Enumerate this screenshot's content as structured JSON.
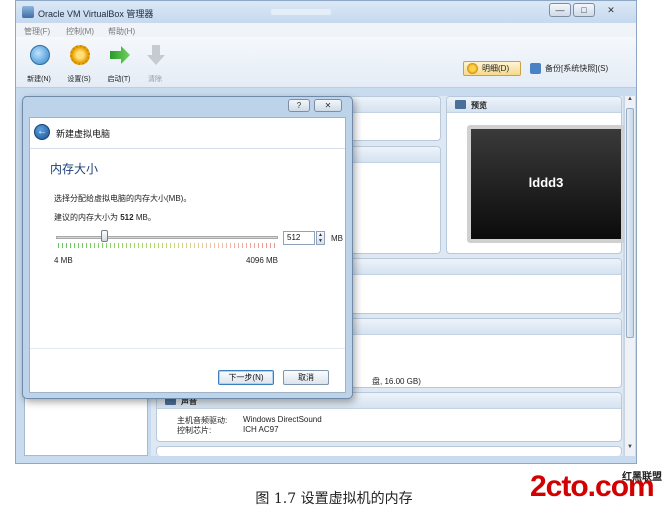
{
  "window": {
    "title": "Oracle VM VirtualBox 管理器"
  },
  "menu": [
    "管理(F)",
    "控制(M)",
    "帮助(H)"
  ],
  "toolbar": {
    "new_label": "新建(N)",
    "settings_label": "设置(S)",
    "start_label": "启动(T)",
    "discard_label": "清除",
    "details_label": "明细(D)",
    "snapshots_label": "备份[系统快照](S)"
  },
  "details": {
    "preview_title": "预览",
    "preview_vm_name": "lddd3",
    "storage_fragment": "盘, 16.00 GB)",
    "audio_title": "声音",
    "audio_driver_label": "主机音频驱动:",
    "audio_driver_value": "Windows DirectSound",
    "audio_controller_label": "控制芯片:",
    "audio_controller_value": "ICH AC97"
  },
  "wizard": {
    "title": "新建虚拟电脑",
    "page_title": "内存大小",
    "description": "选择分配给虚拟电脑的内存大小(MB)。",
    "recommend_prefix": "建议的内存大小为",
    "recommend_value": "512",
    "recommend_unit": "MB。",
    "memory_value": "512",
    "memory_unit": "MB",
    "min_label": "4 MB",
    "max_label": "4096 MB",
    "slider": {
      "min": 4,
      "max": 4096,
      "value": 512
    },
    "next_label": "下一步(N)",
    "cancel_label": "取消"
  },
  "caption": "图 1.7   设置虚拟机的内存",
  "watermark": {
    "main": "2cto.com",
    "sub": "红黑联盟"
  },
  "colors": {
    "window_bg": "#c9dcef",
    "dialog_frame": "#bcd3ea",
    "logo_red": "#d20000"
  }
}
